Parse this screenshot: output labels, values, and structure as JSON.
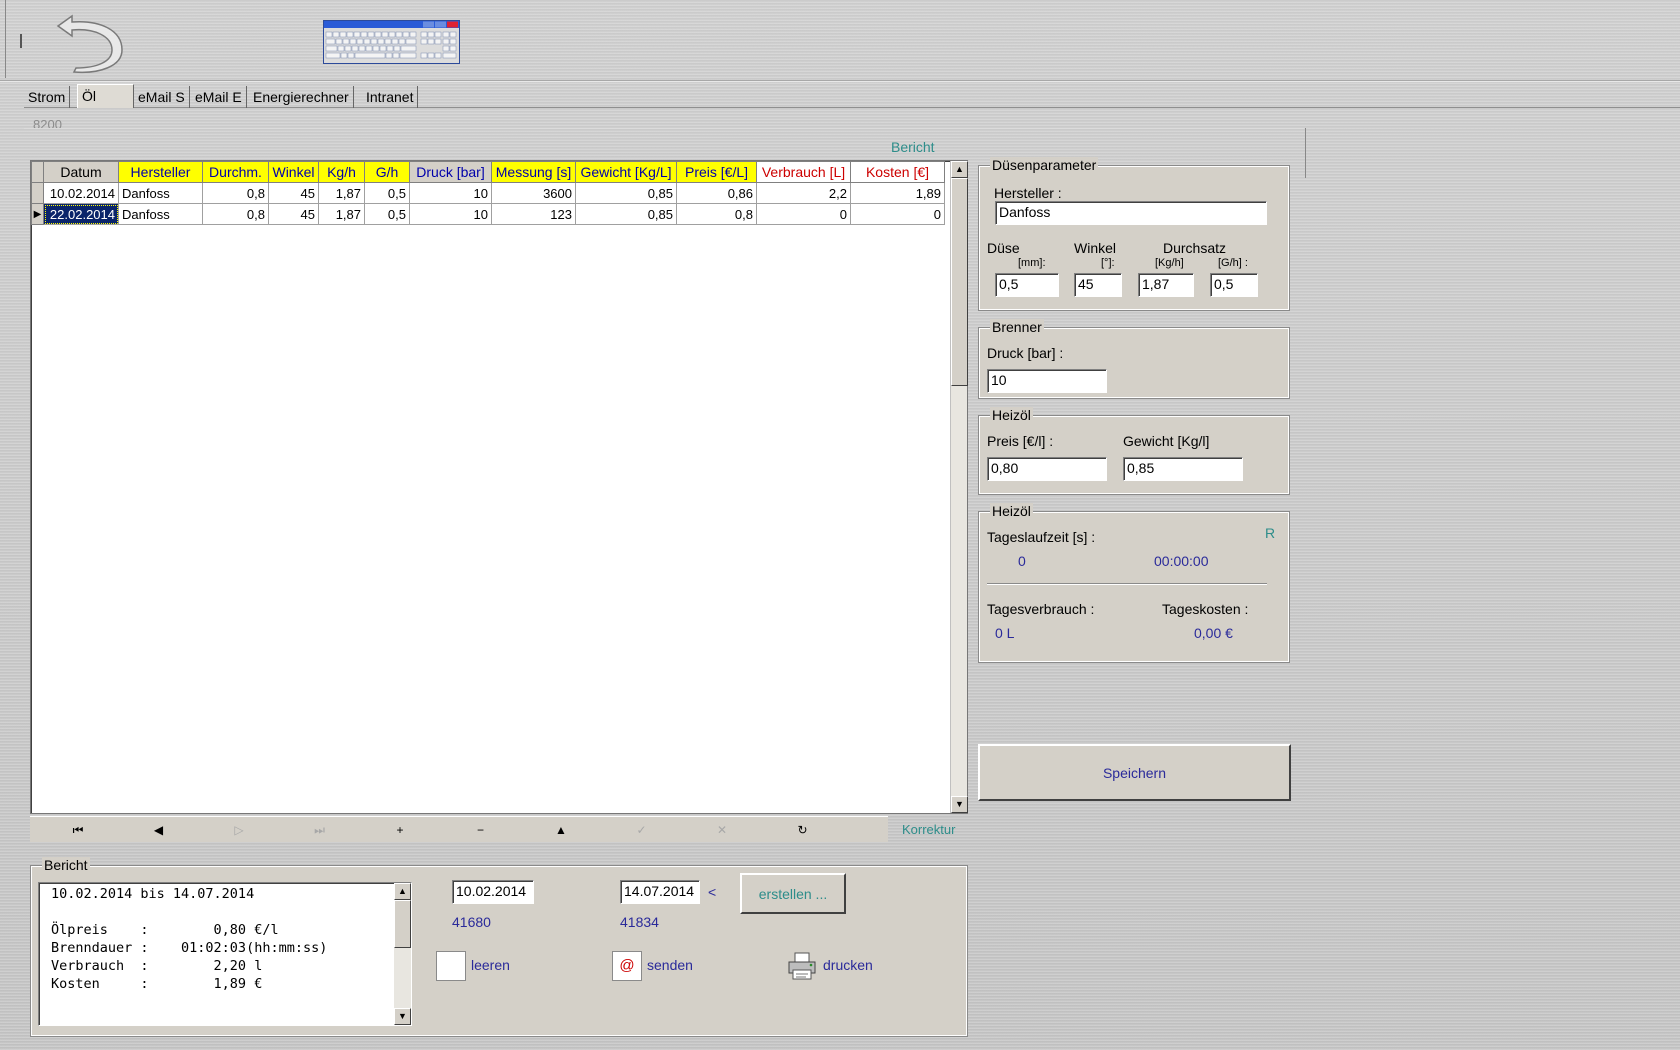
{
  "tabs": [
    {
      "label": "Strom"
    },
    {
      "label": "Öl"
    },
    {
      "label": "eMail S"
    },
    {
      "label": "eMail E"
    },
    {
      "label": "Energierechner"
    },
    {
      "label": "Intranet"
    }
  ],
  "meta": {
    "code": "8200",
    "bericht_link": "Bericht"
  },
  "grid": {
    "columns": [
      {
        "label": "Datum",
        "color": "#000000",
        "bg": "#d4d0c8"
      },
      {
        "label": "Hersteller",
        "color": "#0000aa",
        "bg": "#ffff00"
      },
      {
        "label": "Durchm.",
        "color": "#0000aa",
        "bg": "#ffff00"
      },
      {
        "label": "Winkel",
        "color": "#0000aa",
        "bg": "#ffff00"
      },
      {
        "label": "Kg/h",
        "color": "#0000aa",
        "bg": "#ffff00"
      },
      {
        "label": "G/h",
        "color": "#0000aa",
        "bg": "#ffff00"
      },
      {
        "label": "Druck [bar]",
        "color": "#0000aa",
        "bg": "#d4d0c8"
      },
      {
        "label": "Messung [s]",
        "color": "#0000aa",
        "bg": "#ffff00"
      },
      {
        "label": "Gewicht [Kg/L]",
        "color": "#0000aa",
        "bg": "#ffff00"
      },
      {
        "label": "Preis [€/L]",
        "color": "#0000aa",
        "bg": "#ffff00"
      },
      {
        "label": "Verbrauch [L]",
        "color": "#cc0000",
        "bg": "#ffffff"
      },
      {
        "label": "Kosten [€]",
        "color": "#cc0000",
        "bg": "#ffffff"
      }
    ],
    "rows": [
      {
        "cells": [
          "10.02.2014",
          "Danfoss",
          "0,8",
          "45",
          "1,87",
          "0,5",
          "10",
          "3600",
          "0,85",
          "0,86",
          "2,2",
          "1,89"
        ],
        "selected": false
      },
      {
        "cells": [
          "22.02.2014",
          "Danfoss",
          "0,8",
          "45",
          "1,87",
          "0,5",
          "10",
          "123",
          "0,85",
          "0,8",
          "0",
          "0"
        ],
        "selected": true
      }
    ]
  },
  "navigator": {
    "buttons": [
      {
        "glyph": "⏮",
        "name": "first",
        "enabled": true
      },
      {
        "glyph": "◀",
        "name": "prior",
        "enabled": true
      },
      {
        "glyph": "▷",
        "name": "next",
        "enabled": false
      },
      {
        "glyph": "⏭",
        "name": "last",
        "enabled": false
      },
      {
        "glyph": "+",
        "name": "insert",
        "enabled": true
      },
      {
        "glyph": "−",
        "name": "delete",
        "enabled": true
      },
      {
        "glyph": "▲",
        "name": "edit",
        "enabled": true
      },
      {
        "glyph": "✓",
        "name": "post",
        "enabled": false
      },
      {
        "glyph": "✕",
        "name": "cancel",
        "enabled": false
      },
      {
        "glyph": "↻",
        "name": "refresh",
        "enabled": true
      }
    ],
    "korrektur": "Korrektur"
  },
  "duesenparameter": {
    "title": "Düsenparameter",
    "hersteller_label": "Hersteller :",
    "hersteller_value": "Danfoss",
    "duese_label": "Düse",
    "duese_unit": "[mm]:",
    "duese_value": "0,5",
    "winkel_label": "Winkel",
    "winkel_unit": "[°]:",
    "winkel_value": "45",
    "durchsatz_label": "Durchsatz",
    "kgh_unit": "[Kg/h]",
    "kgh_value": "1,87",
    "gh_unit": "[G/h] :",
    "gh_value": "0,5"
  },
  "brenner": {
    "title": "Brenner",
    "druck_label": "Druck [bar] :",
    "druck_value": "10"
  },
  "heizoel": {
    "title": "Heizöl",
    "preis_label": "Preis [€/l] :",
    "preis_value": "0,80",
    "gewicht_label": "Gewicht [Kg/l]",
    "gewicht_value": "0,85"
  },
  "heizoel2": {
    "title": "Heizöl",
    "r_marker": "R",
    "laufzeit_label": "Tageslaufzeit [s] :",
    "laufzeit_value": "0",
    "laufzeit_time": "00:00:00",
    "verbrauch_label": "Tagesverbrauch :",
    "verbrauch_value": "0 L",
    "kosten_label": "Tageskosten :",
    "kosten_value": "0,00 €"
  },
  "speichern_label": "Speichern",
  "bericht": {
    "title": "Bericht",
    "memo_text": "10.02.2014 bis 14.07.2014\n\nÖlpreis    :        0,80 €/l\nBrenndauer :    01:02:03(hh:mm:ss)\nVerbrauch  :        2,20 l\nKosten     :        1,89 €",
    "from_date": "10.02.2014",
    "to_date": "14.07.2014",
    "from_serial": "41680",
    "to_serial": "41834",
    "lt_marker": "<",
    "erstellen_label": "erstellen ...",
    "leeren_label": "leeren",
    "senden_label": "senden",
    "drucken_label": "drucken"
  }
}
